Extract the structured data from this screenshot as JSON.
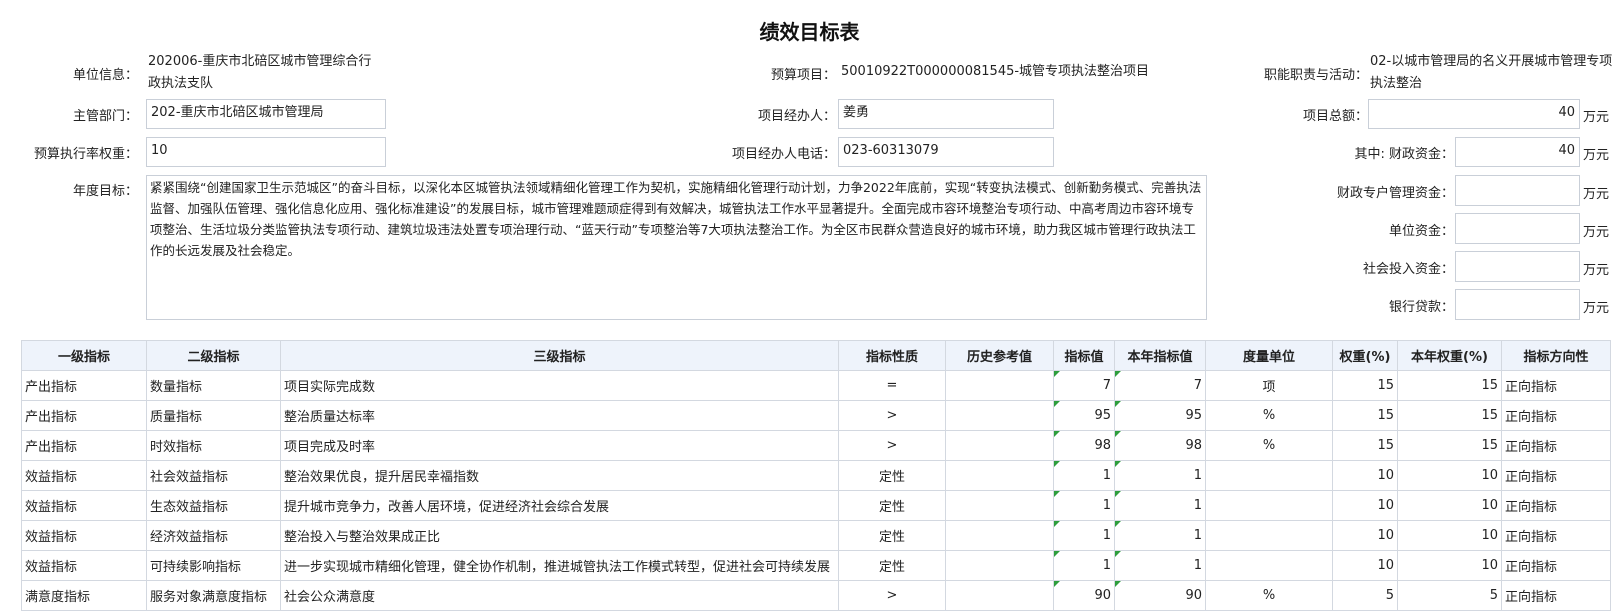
{
  "title": "绩效目标表",
  "info": {
    "unit_label": "单位信息：",
    "unit_value": "202006-重庆市北碚区城市管理综合行政执法支队",
    "budget_project_label": "预算项目：",
    "budget_project_value": "50010922T000000081545-城管专项执法整治项目",
    "duty_label": "职能职责与活动：",
    "duty_value": "02-以城市管理局的名义开展城市管理专项执法整治",
    "dept_label": "主管部门：",
    "dept_value": "202-重庆市北碚区城市管理局",
    "manager_label": "项目经办人：",
    "manager_value": "姜勇",
    "total_label": "项目总额：",
    "total_value": "40",
    "weight_label": "预算执行率权重：",
    "weight_value": "10",
    "phone_label": "项目经办人电话：",
    "phone_value": "023-60313079",
    "fiscal_label": "其中:  财政资金：",
    "fiscal_value": "40",
    "special_label": "财政专户管理资金：",
    "special_value": "",
    "unitfund_label": "单位资金：",
    "unitfund_value": "",
    "social_label": "社会投入资金：",
    "social_value": "",
    "loan_label": "银行贷款：",
    "loan_value": "",
    "unit_wan": "万元",
    "goal_label": "年度目标：",
    "goal_text": "紧紧围绕“创建国家卫生示范城区”的奋斗目标，以深化本区城管执法领域精细化管理工作为契机，实施精细化管理行动计划，力争2022年底前，实现“转变执法模式、创新勤务模式、完善执法监督、加强队伍管理、强化信息化应用、强化标准建设”的发展目标，城市管理难题顽症得到有效解决，城管执法工作水平显著提升。全面完成市容环境整治专项行动、中高考周边市容环境专项整治、生活垃圾分类监管执法专项行动、建筑垃圾违法处置专项治理行动、“蓝天行动”专项整治等7大项执法整治工作。为全区市民群众营造良好的城市环境，助力我区城市管理行政执法工作的长远发展及社会稳定。"
  },
  "table": {
    "headers": [
      "一级指标",
      "二级指标",
      "三级指标",
      "指标性质",
      "历史参考值",
      "指标值",
      "本年指标值",
      "度量单位",
      "权重(%)",
      "本年权重(%)",
      "指标方向性"
    ],
    "rows": [
      [
        "产出指标",
        "数量指标",
        "项目实际完成数",
        "=",
        "",
        "7",
        "7",
        "项",
        "15",
        "15",
        "正向指标"
      ],
      [
        "产出指标",
        "质量指标",
        "整治质量达标率",
        ">",
        "",
        "95",
        "95",
        "%",
        "15",
        "15",
        "正向指标"
      ],
      [
        "产出指标",
        "时效指标",
        "项目完成及时率",
        ">",
        "",
        "98",
        "98",
        "%",
        "15",
        "15",
        "正向指标"
      ],
      [
        "效益指标",
        "社会效益指标",
        "整治效果优良，提升居民幸福指数",
        "定性",
        "",
        "1",
        "1",
        "",
        "10",
        "10",
        "正向指标"
      ],
      [
        "效益指标",
        "生态效益指标",
        "提升城市竞争力，改善人居环境，促进经济社会综合发展",
        "定性",
        "",
        "1",
        "1",
        "",
        "10",
        "10",
        "正向指标"
      ],
      [
        "效益指标",
        "经济效益指标",
        "整治投入与整治效果成正比",
        "定性",
        "",
        "1",
        "1",
        "",
        "10",
        "10",
        "正向指标"
      ],
      [
        "效益指标",
        "可持续影响指标",
        "进一步实现城市精细化管理，健全协作机制，推进城管执法工作模式转型，促进社会可持续发展",
        "定性",
        "",
        "1",
        "1",
        "",
        "10",
        "10",
        "正向指标"
      ],
      [
        "满意度指标",
        "服务对象满意度指标",
        "社会公众满意度",
        ">",
        "",
        "90",
        "90",
        "%",
        "5",
        "5",
        "正向指标"
      ]
    ]
  }
}
